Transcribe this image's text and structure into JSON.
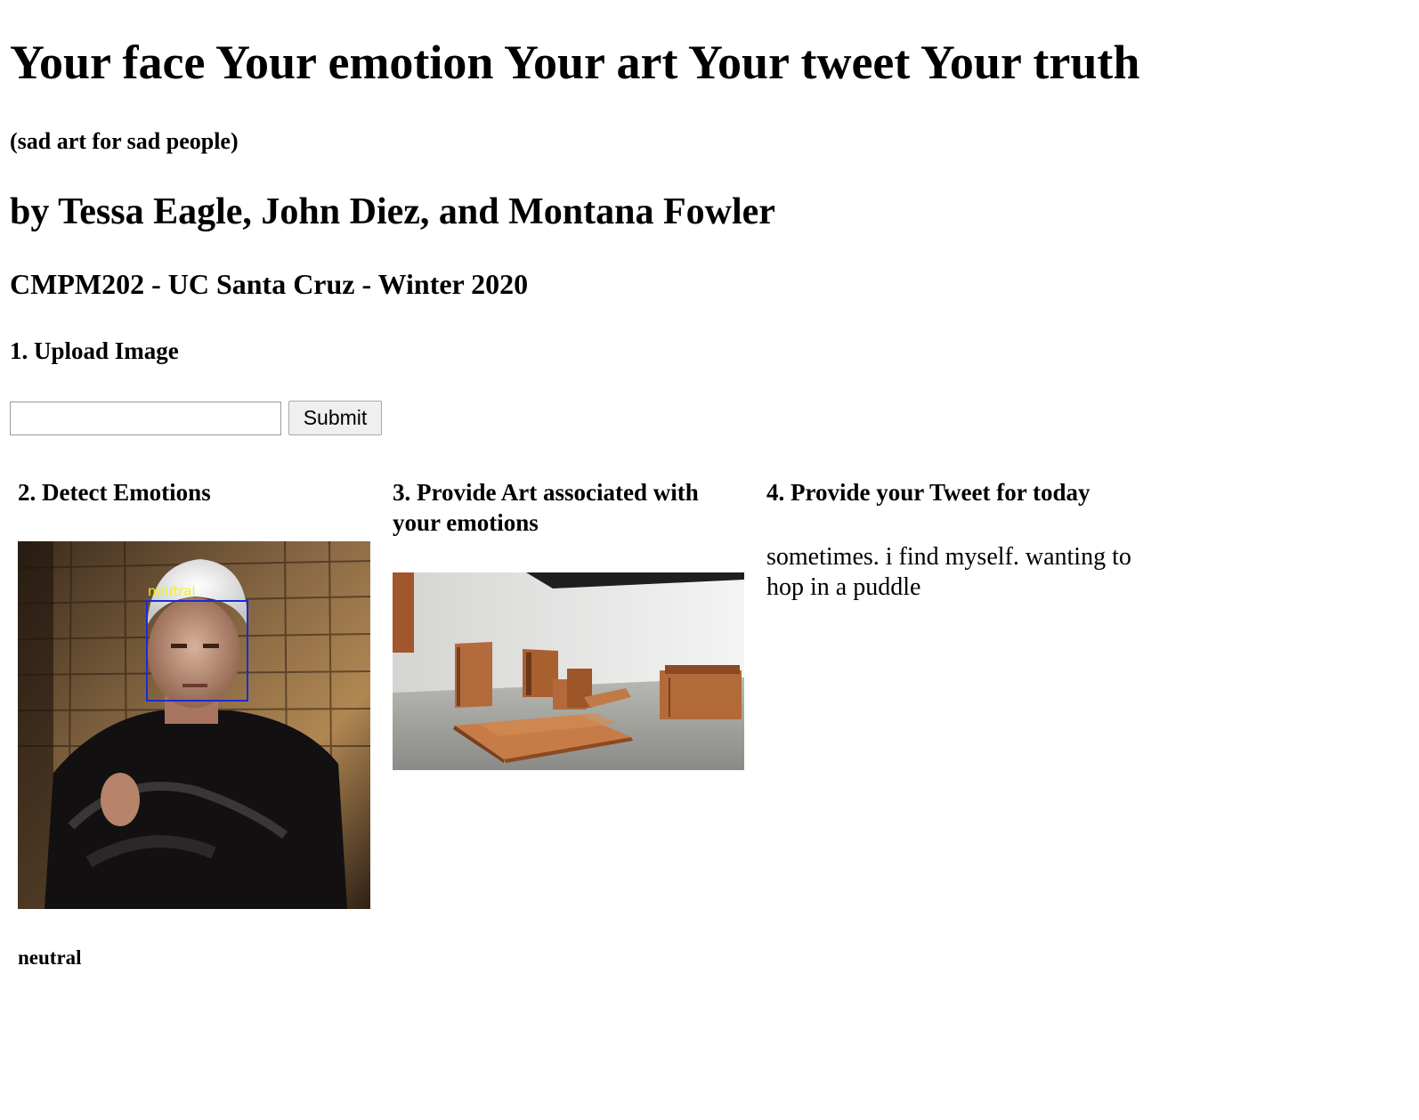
{
  "header": {
    "title": "Your face Your emotion Your art Your tweet Your truth",
    "subtitle": "(sad art for sad people)",
    "authors": "by Tessa Eagle, John Diez, and Montana Fowler",
    "course": "CMPM202 - UC Santa Cruz - Winter 2020"
  },
  "upload": {
    "heading": "1. Upload Image",
    "input_value": "",
    "submit_label": "Submit"
  },
  "detect": {
    "heading": "2. Detect Emotions",
    "face_label": "neutral",
    "result": "neutral"
  },
  "art": {
    "heading": "3. Provide Art associated with your emotions"
  },
  "tweet": {
    "heading": "4. Provide your Tweet for today",
    "text": "sometimes. i find myself. wanting to hop in a puddle"
  }
}
